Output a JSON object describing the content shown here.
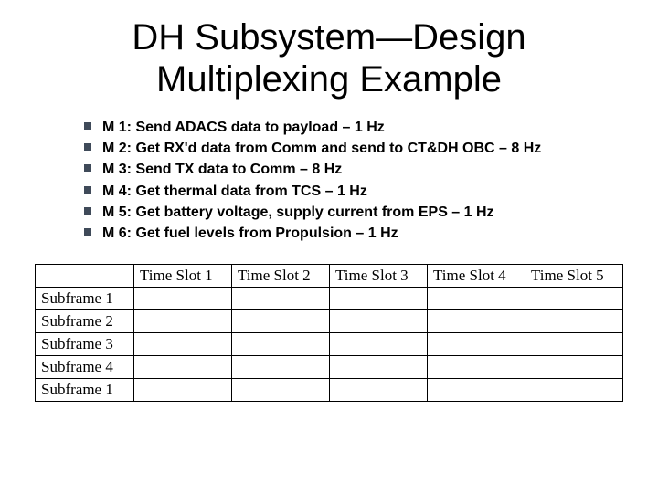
{
  "title_line1": "DH Subsystem—Design",
  "title_line2": "Multiplexing Example",
  "bullets": [
    "M 1: Send ADACS data to payload – 1 Hz",
    "M 2: Get RX'd data from Comm and send to CT&DH OBC – 8 Hz",
    "M 3: Send TX data to Comm – 8 Hz",
    "M 4: Get thermal data from TCS – 1 Hz",
    "M 5: Get battery voltage, supply current from EPS – 1 Hz",
    "M 6: Get fuel levels from Propulsion – 1 Hz"
  ],
  "table": {
    "corner": "",
    "columns": [
      "Time Slot 1",
      "Time Slot 2",
      "Time Slot 3",
      "Time Slot 4",
      "Time Slot 5"
    ],
    "rows": [
      {
        "label": "Subframe 1",
        "cells": [
          "",
          "",
          "",
          "",
          ""
        ]
      },
      {
        "label": "Subframe 2",
        "cells": [
          "",
          "",
          "",
          "",
          ""
        ]
      },
      {
        "label": "Subframe 3",
        "cells": [
          "",
          "",
          "",
          "",
          ""
        ]
      },
      {
        "label": "Subframe 4",
        "cells": [
          "",
          "",
          "",
          "",
          ""
        ]
      },
      {
        "label": "Subframe 1",
        "cells": [
          "",
          "",
          "",
          "",
          ""
        ]
      }
    ]
  }
}
